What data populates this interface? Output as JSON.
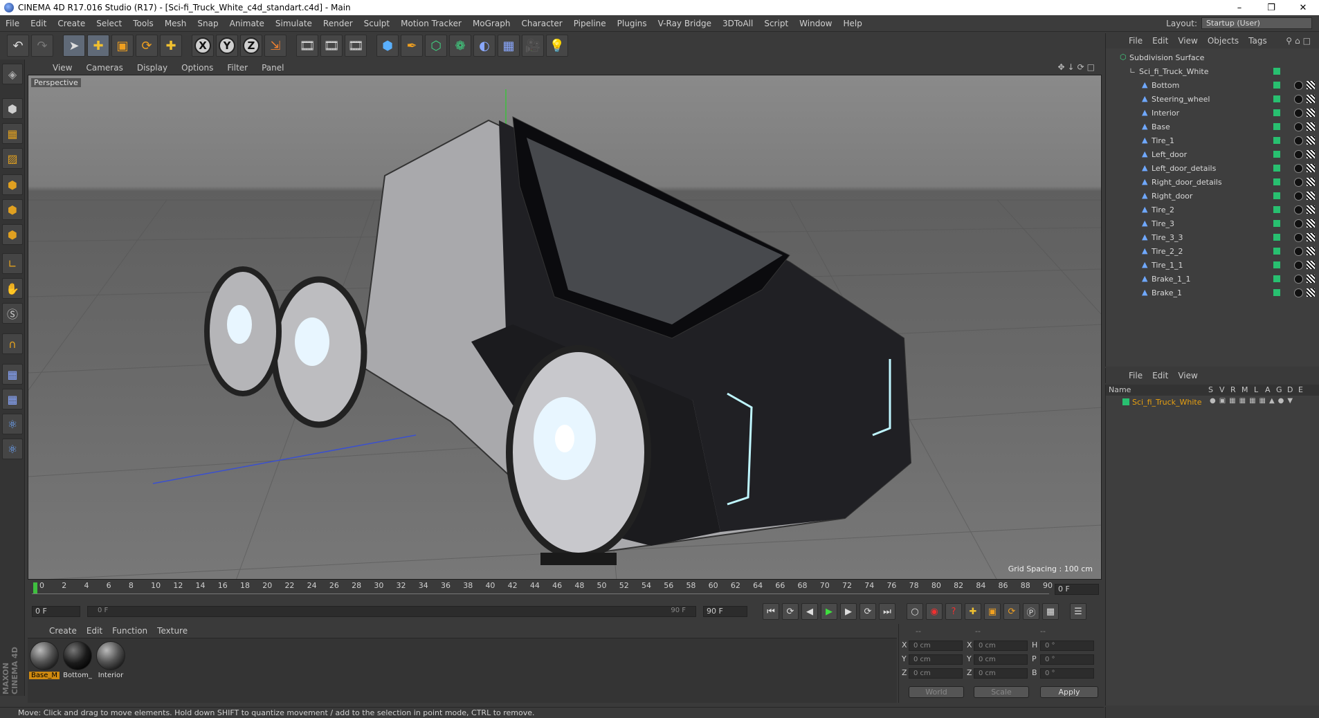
{
  "window": {
    "title": "CINEMA 4D R17.016 Studio (R17) - [Sci-fi_Truck_White_c4d_standart.c4d] - Main",
    "controls": [
      "–",
      "❐",
      "✕"
    ]
  },
  "menubar": {
    "items": [
      "File",
      "Edit",
      "Create",
      "Select",
      "Tools",
      "Mesh",
      "Snap",
      "Animate",
      "Simulate",
      "Render",
      "Sculpt",
      "Motion Tracker",
      "MoGraph",
      "Character",
      "Pipeline",
      "Plugins",
      "V-Ray Bridge",
      "3DToAll",
      "Script",
      "Window",
      "Help"
    ],
    "layout_label": "Layout:",
    "layout_value": "Startup (User)"
  },
  "toolbar": {
    "icons": [
      "undo-icon",
      "redo-icon",
      "select-icon",
      "move-icon",
      "scale-icon",
      "rotate-icon",
      "last-tool-icon",
      "x-axis-icon",
      "y-axis-icon",
      "z-axis-icon",
      "coordinate-system-icon",
      "render-view-icon",
      "render-picture-viewer-icon",
      "render-settings-icon",
      "cube-icon",
      "pen-icon",
      "subdivision-icon",
      "cloner-icon",
      "deformer-icon",
      "floor-icon",
      "camera-icon",
      "light-icon"
    ],
    "axis_labels": [
      "X",
      "Y",
      "Z"
    ]
  },
  "viewport": {
    "menu": [
      "View",
      "Cameras",
      "Display",
      "Options",
      "Filter",
      "Panel"
    ],
    "label": "Perspective",
    "grid_spacing": "Grid Spacing : 100 cm"
  },
  "timeline": {
    "ticks": [
      "0",
      "2",
      "4",
      "6",
      "8",
      "10",
      "12",
      "14",
      "16",
      "18",
      "20",
      "22",
      "24",
      "26",
      "28",
      "30",
      "32",
      "34",
      "36",
      "38",
      "40",
      "42",
      "44",
      "46",
      "48",
      "50",
      "52",
      "54",
      "56",
      "58",
      "60",
      "62",
      "64",
      "66",
      "68",
      "70",
      "72",
      "74",
      "76",
      "78",
      "80",
      "82",
      "84",
      "86",
      "88",
      "90"
    ],
    "current_frame": "0 F",
    "start_field": "0 F",
    "range_start": "0 F",
    "range_end": "90 F",
    "end_field": "90 F"
  },
  "materials": {
    "menu": [
      "Create",
      "Edit",
      "Function",
      "Texture"
    ],
    "items": [
      {
        "name": "Base_M",
        "selected": true
      },
      {
        "name": "Bottom_",
        "selected": false
      },
      {
        "name": "Interior",
        "selected": false
      }
    ]
  },
  "coords": {
    "headers": [
      "--",
      "--",
      "--"
    ],
    "rows": [
      {
        "l1": "X",
        "v1": "0 cm",
        "l2": "X",
        "v2": "0 cm",
        "l3": "H",
        "v3": "0 °"
      },
      {
        "l1": "Y",
        "v1": "0 cm",
        "l2": "Y",
        "v2": "0 cm",
        "l3": "P",
        "v3": "0 °"
      },
      {
        "l1": "Z",
        "v1": "0 cm",
        "l2": "Z",
        "v2": "0 cm",
        "l3": "B",
        "v3": "0 °"
      }
    ],
    "world": "World",
    "scale": "Scale",
    "apply": "Apply"
  },
  "status": "Move: Click and drag to move elements. Hold down SHIFT to quantize movement / add to the selection in point mode, CTRL to remove.",
  "object_manager": {
    "menu": [
      "File",
      "Edit",
      "View",
      "Objects",
      "Tags"
    ],
    "root": "Subdivision Surface",
    "group": "Sci_fi_Truck_White",
    "children": [
      "Bottom",
      "Steering_wheel",
      "Interior",
      "Base",
      "Tire_1",
      "Left_door",
      "Left_door_details",
      "Right_door_details",
      "Right_door",
      "Tire_2",
      "Tire_3",
      "Tire_3_3",
      "Tire_2_2",
      "Tire_1_1",
      "Brake_1_1",
      "Brake_1"
    ]
  },
  "layer_manager": {
    "menu": [
      "File",
      "Edit",
      "View"
    ],
    "columns": [
      "Name",
      "S",
      "V",
      "R",
      "M",
      "L",
      "A",
      "G",
      "D",
      "E"
    ],
    "rows": [
      "Sci_fi_Truck_White"
    ]
  },
  "colors": {
    "accent": "#d08a10",
    "layer_green": "#28c070",
    "selected_text": "#e8a010"
  },
  "branding": "MAXON CINEMA 4D"
}
